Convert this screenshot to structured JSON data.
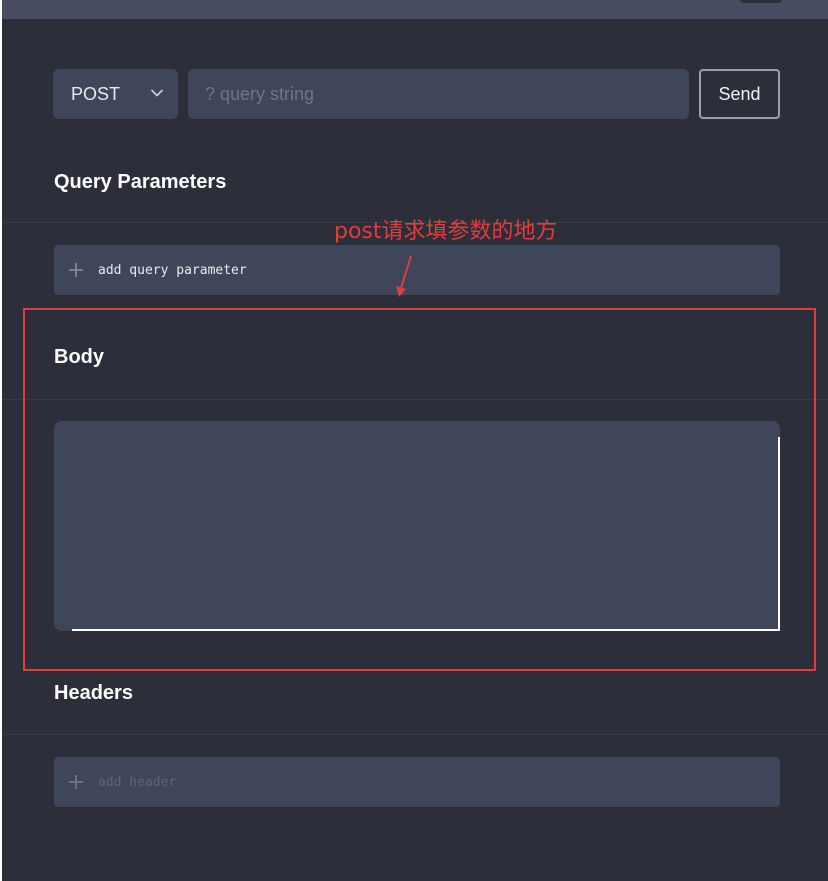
{
  "request": {
    "method": "POST",
    "query_placeholder": "? query string",
    "send_label": "Send"
  },
  "sections": {
    "query_parameters": {
      "title": "Query Parameters",
      "add_label": "add query parameter"
    },
    "body": {
      "title": "Body"
    },
    "headers": {
      "title": "Headers",
      "add_label": "add header"
    }
  },
  "annotation": {
    "text": "post请求填参数的地方",
    "color": "#e23c3c"
  },
  "icons": {
    "method_dropdown": "chevron-down-icon",
    "add": "plus-icon"
  },
  "colors": {
    "background": "#2c2e39",
    "panel": "#40465a",
    "topbar": "#494d63",
    "text": "#ffffff"
  }
}
